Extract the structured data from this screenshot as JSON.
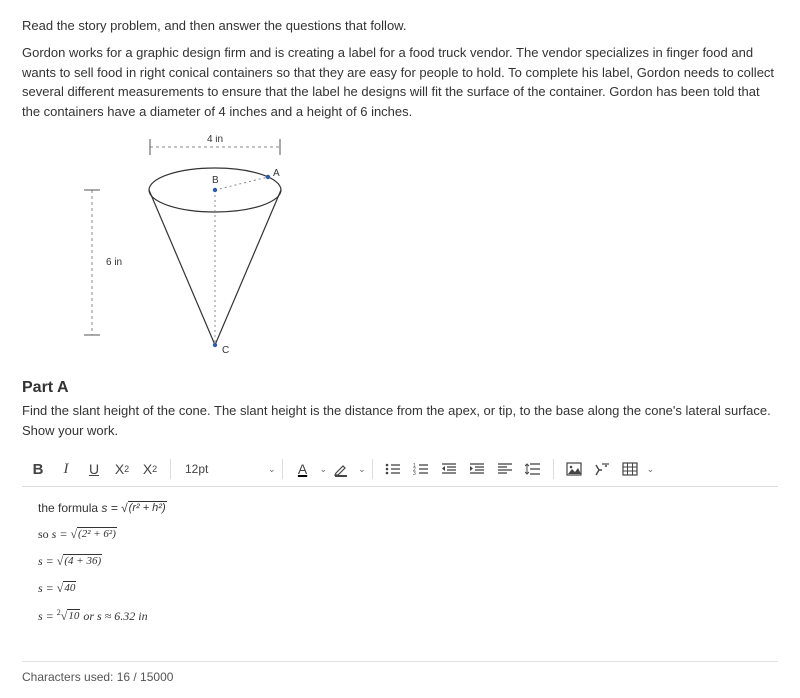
{
  "instruction": "Read the story problem, and then answer the questions that follow.",
  "story": "Gordon works for a graphic design firm and is creating a label for a food truck vendor. The vendor specializes in finger food and wants to sell food in right conical containers so that they are easy for people to hold. To complete his label, Gordon needs to collect several different measurements to ensure that the label he designs will fit the surface of the container. Gordon has been told that the containers have a diameter of 4 inches and a height of 6 inches.",
  "diagram": {
    "width_label": "4 in",
    "height_label": "6 in",
    "point_a": "A",
    "point_b": "B",
    "point_c": "C"
  },
  "part": {
    "title": "Part A",
    "prompt": "Find the slant height of the cone. The slant height is the distance from the apex, or tip, to the base along the cone's lateral surface. Show your work."
  },
  "toolbar": {
    "bold": "B",
    "italic": "I",
    "underline": "U",
    "sup_base": "X",
    "sup_exp": "2",
    "sub_base": "X",
    "sub_exp": "2",
    "font_size": "12pt",
    "font_color_letter": "A"
  },
  "answer": {
    "line1_prefix": "the formula ",
    "line1_lhs": "s = ",
    "line1_under": "(r² + h²)",
    "line2_prefix": "so ",
    "line2_lhs": "s = ",
    "line2_under": "(2² + 6²)",
    "line3_lhs": "s = ",
    "line3_under": "(4 + 36)",
    "line4_lhs": "s = ",
    "line4_under": "40",
    "line5_lhs": "s = ",
    "line5_rootindex": "2",
    "line5_under": "10",
    "line5_suffix": " or s ≈ 6.32 in"
  },
  "counter": "Characters used: 16 / 15000"
}
